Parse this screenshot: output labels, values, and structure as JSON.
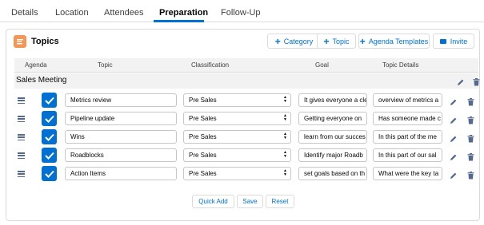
{
  "tabs": [
    {
      "label": "Details"
    },
    {
      "label": "Location"
    },
    {
      "label": "Attendees"
    },
    {
      "label": "Preparation",
      "active": true
    },
    {
      "label": "Follow-Up"
    }
  ],
  "card": {
    "title": "Topics",
    "icon": "topics-icon",
    "icon_color": "#f49756"
  },
  "header_buttons": {
    "category": "Category",
    "topic": "Topic",
    "agenda_templates": "Agenda Templates",
    "invite": "Invite"
  },
  "table": {
    "headers": {
      "agenda": "Agenda",
      "topic": "Topic",
      "classification": "Classification",
      "goal": "Goal",
      "details": "Topic Details"
    },
    "group": "Sales Meeting",
    "rows": [
      {
        "topic": "Metrics review",
        "classification": "Pre Sales",
        "goal": "It gives everyone a cle",
        "details": "overview of metrics a"
      },
      {
        "topic": "Pipeline update",
        "classification": "Pre Sales",
        "goal": "Getting everyone on",
        "details": "Has someone made c"
      },
      {
        "topic": "Wins",
        "classification": "Pre Sales",
        "goal": "learn from our succes",
        "details": "In this part of the me"
      },
      {
        "topic": "Roadblocks",
        "classification": "Pre Sales",
        "goal": "Identify major Roadb",
        "details": "In this part of our sal"
      },
      {
        "topic": "Action Items",
        "classification": "Pre Sales",
        "goal": "set goals based on th",
        "details": "What were the key ta"
      }
    ]
  },
  "footer": {
    "quick_add": "Quick Add",
    "save": "Save",
    "reset": "Reset"
  },
  "colors": {
    "accent": "#0070d2",
    "border": "#dddbda",
    "header_bg": "#f3f2f2"
  }
}
